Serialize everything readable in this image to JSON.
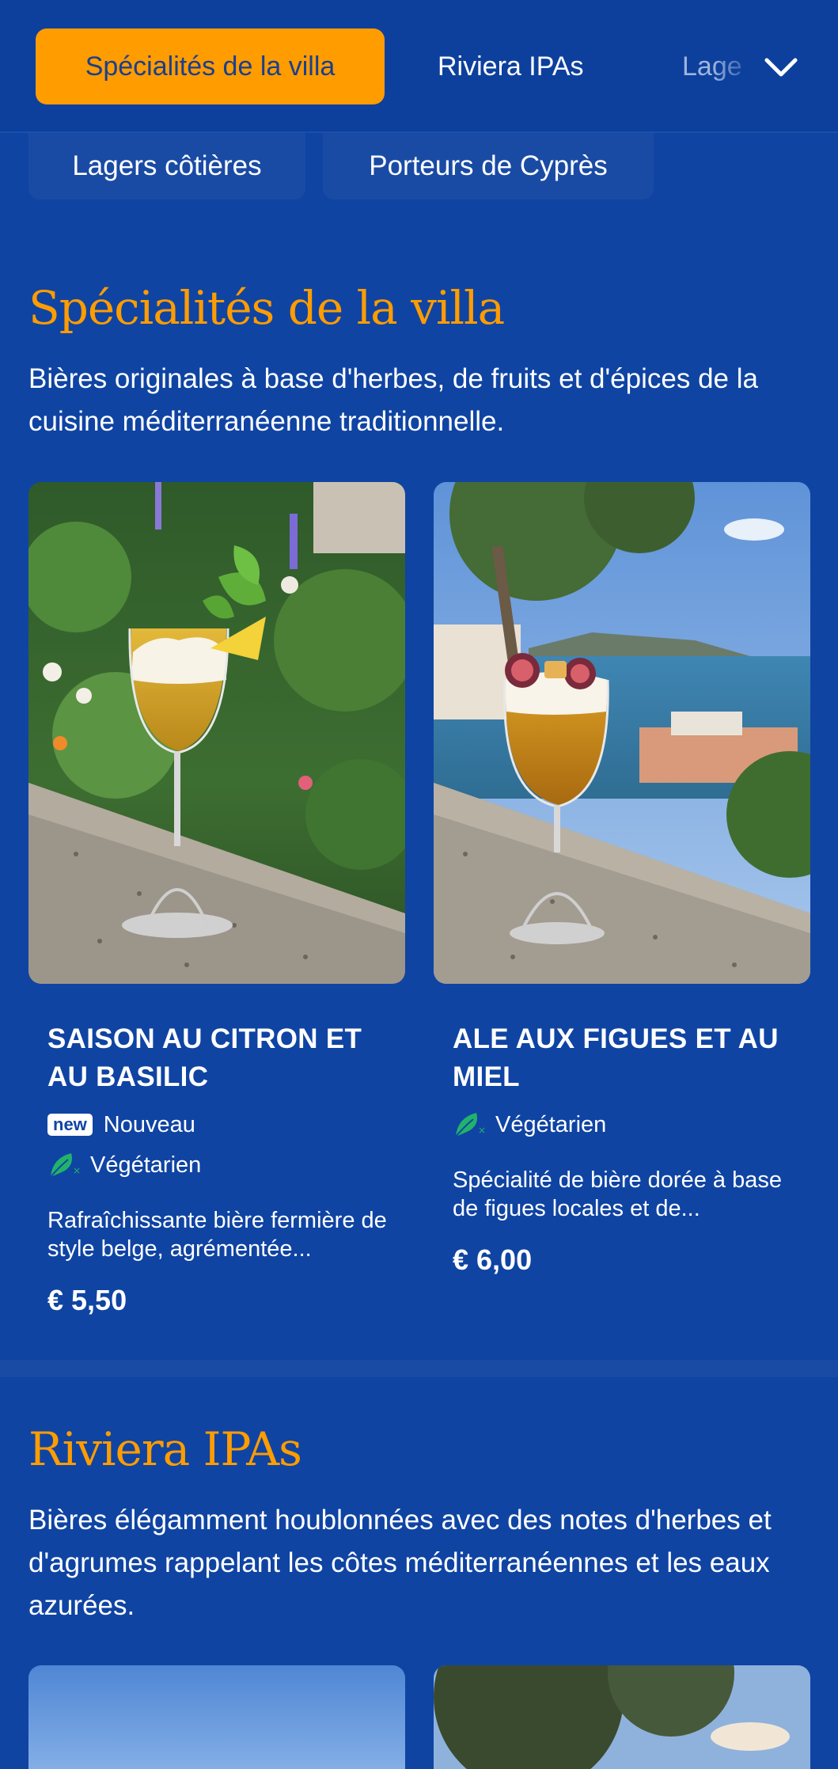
{
  "nav": {
    "tabs": [
      {
        "label": "Spécialités de la villa",
        "active": true
      },
      {
        "label": "Riviera IPAs",
        "active": false
      },
      {
        "label": "Lage",
        "active": false
      }
    ],
    "expand_icon": "chevron-down-icon",
    "pills": [
      "Lagers côtières",
      "Porteurs de Cyprès"
    ]
  },
  "sections": [
    {
      "title": "Spécialités de la villa",
      "description": "Bières originales à base d'herbes, de fruits et d'épices de la cuisine méditerranéenne traditionnelle.",
      "items": [
        {
          "name": "SAISON AU CITRON ET AU BASILIC",
          "badge_new": "new",
          "badge_new_label": "Nouveau",
          "diet_label": "Végétarien",
          "diet_icon": "vegetarian-leaf-icon",
          "description": "Rafraîchissante bière fermière de style belge, agrémentée...",
          "price": "€ 5,50"
        },
        {
          "name": "ALE AUX FIGUES ET AU MIEL",
          "diet_label": "Végétarien",
          "diet_icon": "vegetarian-leaf-icon",
          "description": "Spécialité de bière dorée à base de figues locales et de...",
          "price": "€ 6,00"
        }
      ]
    },
    {
      "title": "Riviera IPAs",
      "description": "Bières élégamment houblonnées avec des notes d'herbes et d'agrumes rappelant les côtes méditerranéennes et les eaux azurées."
    }
  ],
  "colors": {
    "background": "#0f44a3",
    "accent": "#ff9c00",
    "vegetarian": "#21b36b"
  }
}
